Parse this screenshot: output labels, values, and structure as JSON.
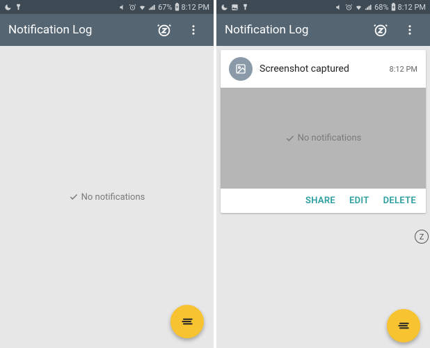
{
  "left": {
    "status": {
      "battery": "67%",
      "time": "8:12 PM"
    },
    "appbar": {
      "title": "Notification Log"
    },
    "empty": "No notifications"
  },
  "right": {
    "status": {
      "battery": "68%",
      "time": "8:12 PM"
    },
    "appbar": {
      "title": "Notification Log"
    },
    "notification": {
      "title": "Screenshot captured",
      "time": "8:12 PM",
      "preview_empty": "No notifications",
      "actions": {
        "share": "SHARE",
        "edit": "EDIT",
        "delete": "DELETE"
      }
    }
  },
  "colors": {
    "accent": "#2a9d9d",
    "fab": "#f7c331",
    "appbar": "#556572"
  }
}
